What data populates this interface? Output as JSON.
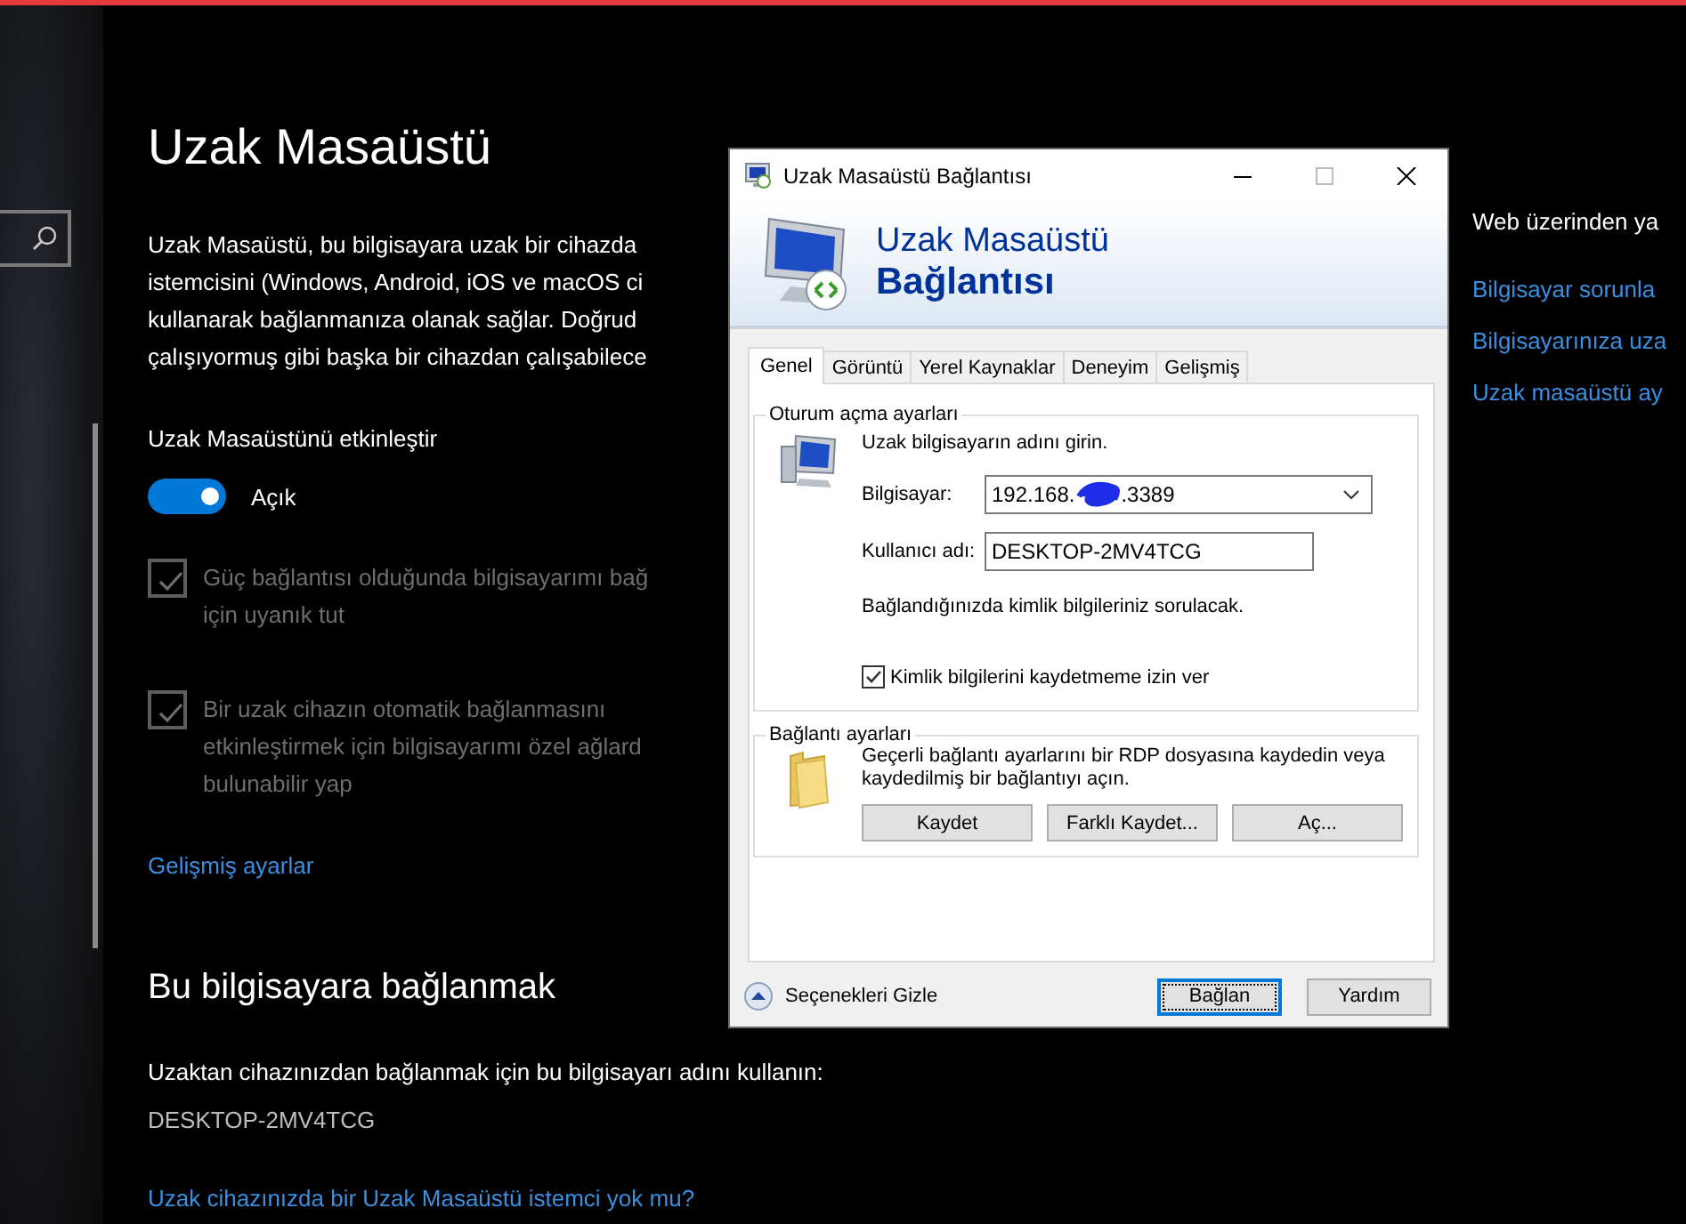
{
  "settings": {
    "title": "Uzak Masaüstü",
    "description_lines": [
      "Uzak Masaüstü, bu bilgisayara uzak bir cihazda",
      "istemcisini (Windows, Android, iOS ve macOS ci",
      "kullanarak bağlanmanıza olanak sağlar. Doğrud",
      "çalışıyormuş gibi başka bir cihazdan çalışabilece"
    ],
    "toggle": {
      "label": "Uzak Masaüstünü etkinleştir",
      "on": true,
      "state_text": "Açık"
    },
    "options": [
      {
        "lines": [
          "Güç bağlantısı olduğunda bilgisayarımı bağ",
          "için uyanık tut"
        ],
        "checked": true,
        "disabled": true
      },
      {
        "lines": [
          "Bir uzak cihazın otomatik bağlanmasını",
          "etkinleştirmek için bilgisayarımı özel ağlard",
          "bulunabilir yap"
        ],
        "checked": true,
        "disabled": true
      }
    ],
    "advanced_link": "Gelişmiş ayarlar",
    "section_title": "Bu bilgisayara bağlanmak",
    "section_text": "Uzaktan cihazınızdan bağlanmak için bu bilgisayarı adını kullanın:",
    "pc_name": "DESKTOP-2MV4TCG",
    "client_link": "Uzak cihazınızda bir Uzak Masaüstü istemci yok mu?"
  },
  "web_links": {
    "title": "Web üzerinden ya",
    "links": [
      "Bilgisayar sorunla",
      "Bilgisayarınıza uza",
      "Uzak masaüstü ay"
    ]
  },
  "dialog": {
    "title": "Uzak Masaüstü Bağlantısı",
    "banner_lines": [
      "Uzak Masaüstü",
      "Bağlantısı"
    ],
    "tabs": [
      {
        "label": "Genel",
        "selected": true
      },
      {
        "label": "Görüntü",
        "selected": false
      },
      {
        "label": "Yerel Kaynaklar",
        "selected": false
      },
      {
        "label": "Deneyim",
        "selected": false
      },
      {
        "label": "Gelişmiş",
        "selected": false
      }
    ],
    "logon": {
      "legend": "Oturum açma ayarları",
      "prompt": "Uzak bilgisayarın adını girin.",
      "computer_label": "Bilgisayar:",
      "computer_value_start": "192.168.",
      "computer_value_end": ".3389",
      "user_label": "Kullanıcı adı:",
      "user_value": "DESKTOP-2MV4TCG",
      "info": "Bağlandığınızda kimlik bilgileriniz sorulacak.",
      "save_checkbox": {
        "label": "Kimlik bilgilerini kaydetmeme izin ver",
        "checked": true
      }
    },
    "connection": {
      "legend": "Bağlantı ayarları",
      "text": "Geçerli bağlantı ayarlarını bir RDP dosyasına kaydedin veya kaydedilmiş bir bağlantıyı açın.",
      "buttons": [
        "Kaydet",
        "Farklı Kaydet...",
        "Aç..."
      ]
    },
    "hide_options": "Seçenekleri Gizle",
    "buttons": [
      {
        "label": "Bağlan",
        "default": true
      },
      {
        "label": "Yardım",
        "default": false
      }
    ]
  }
}
